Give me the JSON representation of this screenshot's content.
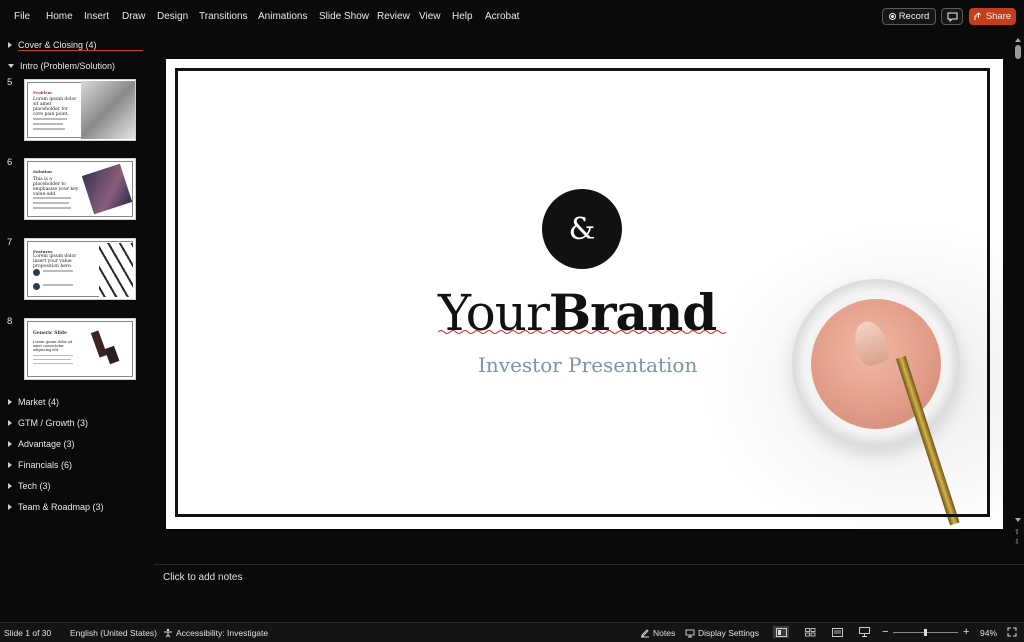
{
  "menu": [
    "File",
    "Home",
    "Insert",
    "Draw",
    "Design",
    "Transitions",
    "Animations",
    "Slide Show",
    "Review",
    "View",
    "Help",
    "Acrobat"
  ],
  "toolbar": {
    "record_label": "Record",
    "share_label": "Share"
  },
  "sidebar": {
    "sections_top": [
      {
        "label": "Cover & Closing (4)",
        "expanded": false
      },
      {
        "label": "Intro (Problem/Solution)",
        "expanded": true
      }
    ],
    "slides": [
      {
        "number": "5",
        "title": "Problem",
        "heading": "Lorem ipsum dolor sit amet placeholder for core pain point."
      },
      {
        "number": "6",
        "title": "Solution",
        "heading": "This is a placeholder to emphasize your key value-add."
      },
      {
        "number": "7",
        "title": "Features",
        "heading": "Lorem ipsum dolor insert your value proposition here."
      },
      {
        "number": "8",
        "title": "Generic Slide",
        "heading": "Lorem ipsum dolor sit amet consectetur adipiscing elit."
      }
    ],
    "sections_bottom": [
      {
        "label": "Market (4)"
      },
      {
        "label": "GTM / Growth (3)"
      },
      {
        "label": "Advantage (3)"
      },
      {
        "label": "Financials (6)"
      },
      {
        "label": "Tech (3)"
      },
      {
        "label": "Team & Roadmap (3)"
      }
    ]
  },
  "slide": {
    "logo_glyph": "&",
    "brand_regular": "Your",
    "brand_bold": "Brand",
    "subtitle": "Investor Presentation"
  },
  "notes": {
    "placeholder": "Click to add notes"
  },
  "status": {
    "slide_counter": "Slide 1 of 30",
    "language": "English (United States)",
    "accessibility": "Accessibility: Investigate",
    "notes_label": "Notes",
    "display_settings": "Display Settings",
    "zoom": "94%",
    "zoom_level": 0.94
  },
  "colors": {
    "accent": "#c43e1c",
    "subtitle": "#7d93aa",
    "background": "#0a0a0a"
  }
}
